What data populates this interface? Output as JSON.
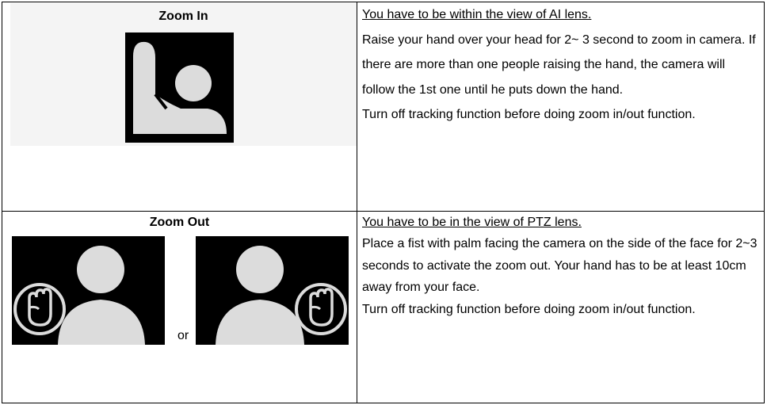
{
  "zoom_in": {
    "heading": "Zoom In",
    "image_icon": "raised-hand-person-icon",
    "paragraphs": [
      "You have to be within the view of AI lens.",
      "Raise your hand over your head for 2~ 3 second to zoom in camera. If there are more than one people raising the hand, the camera will follow the 1st one until he puts down the hand.",
      "Turn off tracking function before doing zoom in/out function."
    ]
  },
  "zoom_out": {
    "heading": "Zoom Out",
    "image_icon": "fist-gesture-person-icon",
    "or_label": "or",
    "paragraphs": [
      "You have to be in the view of PTZ lens.",
      "Place a fist with palm facing the camera on the side of the face for 2~3 seconds to activate the zoom out. Your hand has to be at least 10cm away from your face.",
      "Turn off tracking function before doing zoom in/out function."
    ]
  },
  "colors": {
    "image_bg": "#000000",
    "figure": "#dcdcdc",
    "panel_bg": "#f4f4f4"
  }
}
